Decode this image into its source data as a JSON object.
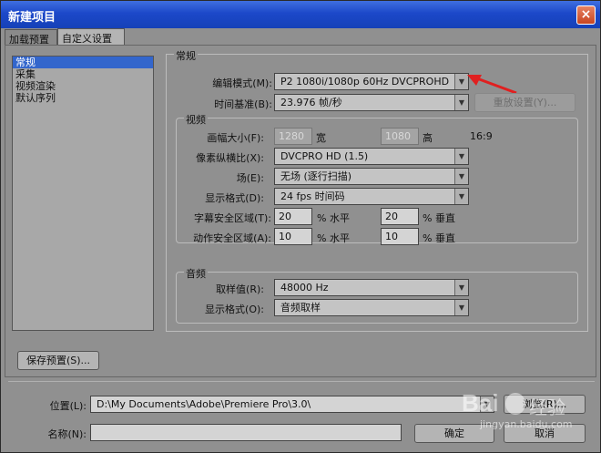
{
  "window": {
    "title": "新建项目",
    "close_glyph": "×"
  },
  "tabs": [
    {
      "label": "加载预置"
    },
    {
      "label": "自定义设置"
    }
  ],
  "sidebar": {
    "items": [
      "常规",
      "采集",
      "视频渲染",
      "默认序列"
    ]
  },
  "general": {
    "group_label": "常规",
    "edit_mode_label": "编辑模式(M):",
    "edit_mode_value": "P2 1080i/1080p 60Hz DVCPROHD",
    "timebase_label": "时间基准(B):",
    "timebase_value": "23.976 帧/秒",
    "replay_button": "重放设置(Y)..."
  },
  "video": {
    "group_label": "视频",
    "frame_size_label": "画幅大小(F):",
    "frame_width": "1280",
    "width_label": "宽",
    "frame_height": "1080",
    "height_label": "高",
    "aspect": "16:9",
    "pixel_aspect_label": "像素纵横比(X):",
    "pixel_aspect_value": "DVCPRO HD (1.5)",
    "fields_label": "场(E):",
    "fields_value": "无场 (逐行扫描)",
    "display_format_label": "显示格式(D):",
    "display_format_value": "24 fps 时间码",
    "title_safe_label": "字幕安全区域(T):",
    "title_safe_h": "20",
    "title_safe_v": "20",
    "action_safe_label": "动作安全区域(A):",
    "action_safe_h": "10",
    "action_safe_v": "10",
    "pct_horizontal": "% 水平",
    "pct_vertical": "% 垂直"
  },
  "audio": {
    "group_label": "音频",
    "sample_rate_label": "取样值(R):",
    "sample_rate_value": "48000 Hz",
    "display_format_label": "显示格式(O):",
    "display_format_value": "音频取样"
  },
  "save_preset_button": "保存预置(S)...",
  "location": {
    "label": "位置(L):",
    "value": "D:\\My Documents\\Adobe\\Premiere Pro\\3.0\\",
    "browse_button": "浏览(R)..."
  },
  "name": {
    "label": "名称(N):",
    "value": ""
  },
  "ok_button": "确定",
  "cancel_button": "取消",
  "watermark": {
    "brand": "Bai",
    "brand2": "经验",
    "url": "jingyan.baidu.com"
  },
  "colors": {
    "title_bar": "#1c48c9",
    "arrow": "#e02020",
    "selection": "#3366cc"
  }
}
